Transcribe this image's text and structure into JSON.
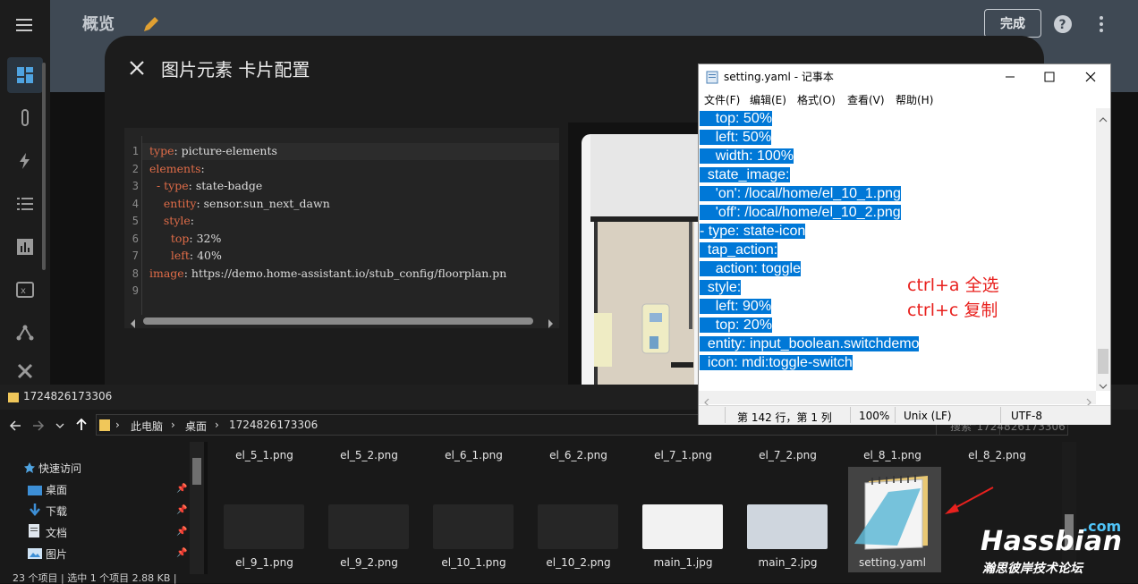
{
  "ha": {
    "page_title": "概览",
    "done_label": "完成",
    "sidebar_icons": [
      "overview-icon",
      "test-tube-icon",
      "lightning-icon",
      "list-icon",
      "chart-icon",
      "variable-icon",
      "network-icon",
      "tools-icon"
    ]
  },
  "dialog": {
    "title": "图片元素 卡片配置",
    "code_lines": [
      {
        "n": "1",
        "key": "type",
        "val": " picture-elements"
      },
      {
        "n": "2",
        "key": "elements",
        "val": ""
      },
      {
        "n": "3",
        "key": "  - type",
        "val": " state-badge"
      },
      {
        "n": "4",
        "key": "    entity",
        "val": " sensor.sun_next_dawn"
      },
      {
        "n": "5",
        "key": "    style",
        "val": ""
      },
      {
        "n": "6",
        "key": "      top",
        "val": " 32%"
      },
      {
        "n": "7",
        "key": "      left",
        "val": " 40%"
      },
      {
        "n": "8",
        "key": "image",
        "val": " https://demo.home-assistant.io/stub_config/floorplan.pn"
      },
      {
        "n": "9",
        "key": "",
        "val": ""
      }
    ]
  },
  "explorer": {
    "window_title": "1724826173306",
    "breadcrumbs": [
      "此电脑",
      "桌面",
      "1724826173306"
    ],
    "search_placeholder": "搜索\"1724826173306\"",
    "nav_items": [
      "快速访问",
      "桌面",
      "下载",
      "文档",
      "图片"
    ],
    "files_row1": [
      "el_5_1.png",
      "el_5_2.png",
      "el_6_1.png",
      "el_6_2.png",
      "el_7_1.png",
      "el_7_2.png",
      "el_8_1.png",
      "el_8_2.png"
    ],
    "files_row2": [
      "el_9_1.png",
      "el_9_2.png",
      "el_10_1.png",
      "el_10_2.png",
      "main_1.jpg",
      "main_2.jpg",
      "setting.yaml"
    ],
    "status": "23 个项目  |  选中 1 个项目  2.88 KB  |"
  },
  "notepad": {
    "title": "setting.yaml - 记事本",
    "menu": [
      "文件(F)",
      "编辑(E)",
      "格式(O)",
      "查看(V)",
      "帮助(H)"
    ],
    "lines": [
      "    top: 50%",
      "    left: 50%",
      "    width: 100%",
      "  state_image:",
      "    'on': /local/home/el_10_1.png",
      "    'off': /local/home/el_10_2.png",
      "- type: state-icon",
      "  tap_action:",
      "    action: toggle",
      "  style:",
      "    left: 90%",
      "    top: 20%",
      "  entity: input_boolean.switchdemo",
      "  icon: mdi:toggle-switch"
    ],
    "status": {
      "position": "第 142 行，第 1 列",
      "zoom": "100%",
      "eol": "Unix (LF)",
      "encoding": "UTF-8"
    },
    "hint_1": "ctrl+a 全选",
    "hint_2": "ctrl+c 复制"
  },
  "watermark": {
    "brand": "Hassbian",
    "tld": ".com",
    "slogan": "瀚思彼岸技术论坛"
  },
  "colors": {
    "selection": "#0078d7",
    "hint_red": "#e8211e",
    "yaml_key": "#e06c48"
  }
}
